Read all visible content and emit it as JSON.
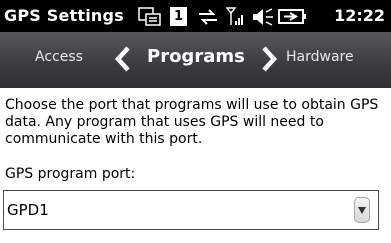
{
  "status_bar": {
    "title": "GPS Settings",
    "time": "12:22",
    "notification_count": "1",
    "icons": [
      "keyboard-icon",
      "notification-icon",
      "connectivity-icon",
      "signal-icon",
      "speaker-icon",
      "battery-icon"
    ]
  },
  "tabs": {
    "previous": "Access",
    "current": "Programs",
    "next": "Hardware"
  },
  "content": {
    "description": "Choose the port that programs will use to obtain GPS data. Any program that uses GPS will need to communicate with this port.",
    "port_label": "GPS program port:",
    "port_value": "GPD1"
  }
}
